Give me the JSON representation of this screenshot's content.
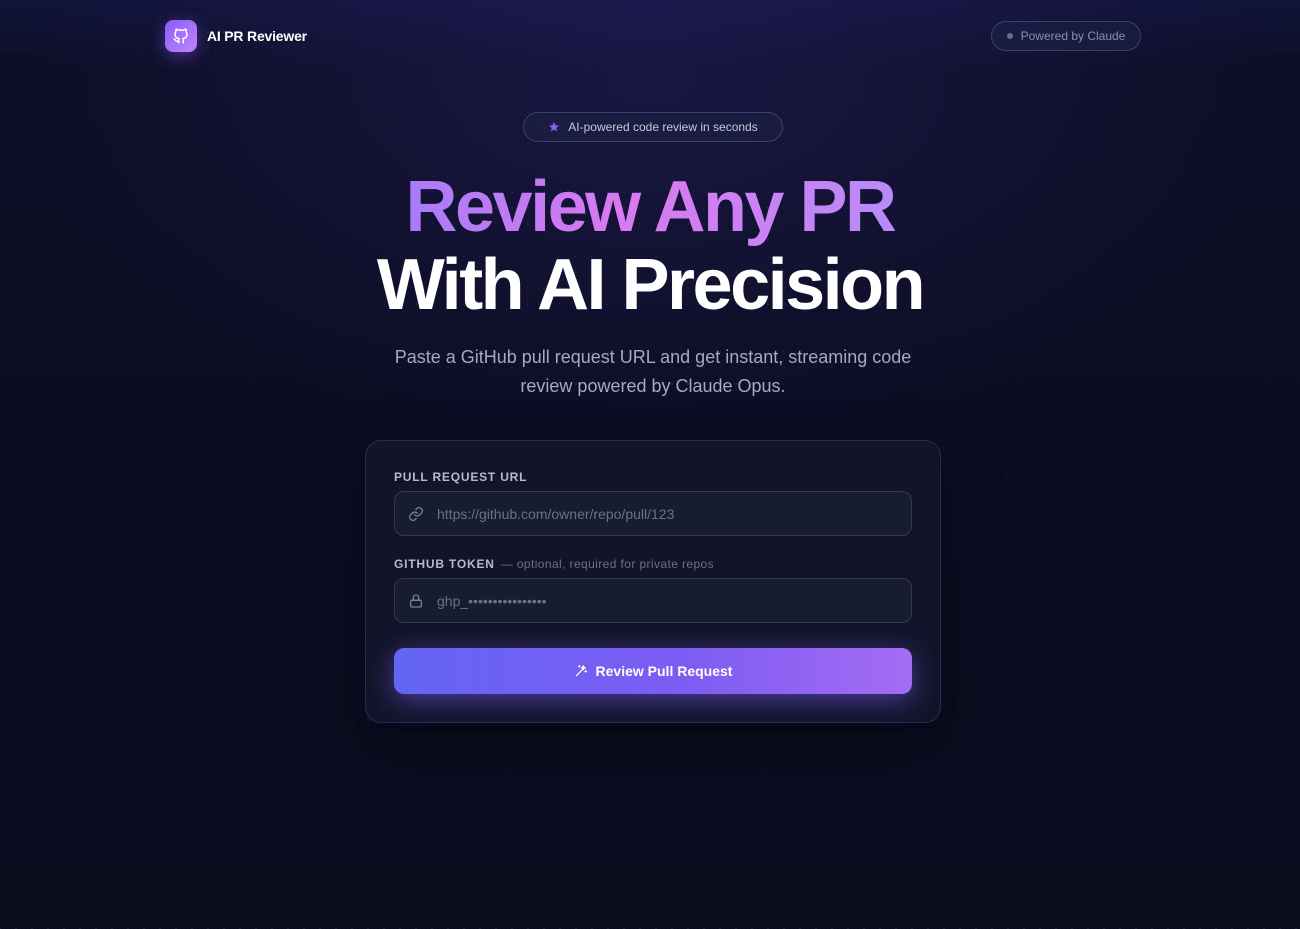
{
  "header": {
    "brand_name": "AI PR Reviewer",
    "logo_icon": "github-icon",
    "powered_label": "Powered by Claude"
  },
  "hero": {
    "badge": "AI-powered code review in seconds",
    "title_line1": "Review Any PR",
    "title_line2": "With AI Precision",
    "subtitle": "Paste a GitHub pull request URL and get instant, streaming code review powered by Claude Opus."
  },
  "form": {
    "url_label": "PULL REQUEST URL",
    "url_placeholder": "https://github.com/owner/repo/pull/123",
    "url_value": "",
    "token_label": "GITHUB TOKEN",
    "token_hint": "— optional, required for private repos",
    "token_placeholder": "ghp_••••••••••••••••",
    "token_value": "",
    "submit_label": "Review Pull Request"
  },
  "colors": {
    "accent": "#8b5cf6",
    "gradient_pink": "#d97af0",
    "button_start": "#6366f1",
    "button_end": "#a46cf4",
    "background": "#0b0d1f"
  }
}
